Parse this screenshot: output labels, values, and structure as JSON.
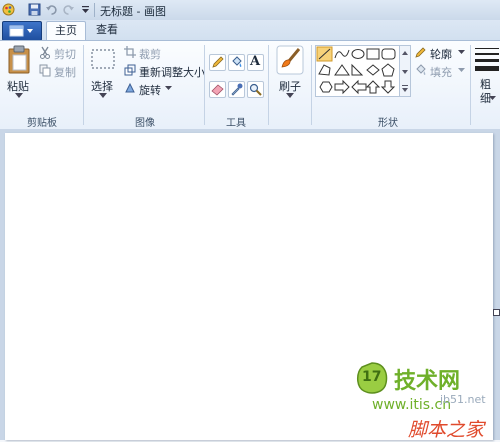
{
  "window": {
    "title": "无标题 - 画图"
  },
  "tabs": [
    {
      "label": "主页",
      "active": true
    },
    {
      "label": "查看",
      "active": false
    }
  ],
  "clipboard": {
    "group_label": "剪贴板",
    "paste_label": "粘贴",
    "cut_label": "剪切",
    "copy_label": "复制"
  },
  "image": {
    "group_label": "图像",
    "select_label": "选择",
    "crop_label": "裁剪",
    "resize_label": "重新调整大小",
    "rotate_label": "旋转"
  },
  "tools": {
    "group_label": "工具",
    "text_tool_glyph": "A"
  },
  "brushes": {
    "label": "刷子"
  },
  "shapes": {
    "group_label": "形状",
    "outline_label": "轮廓",
    "fill_label": "填充"
  },
  "size": {
    "label_line1": "粗",
    "label_line2": "细"
  },
  "watermark": {
    "logo_text": "17",
    "brand_text": "技术网",
    "url_text": "www.itis.cn",
    "partial_text": "jb51.net",
    "sub_text": "脚本之家"
  },
  "colors": {
    "accent": "#2b5ea8",
    "ribbon_bg": "#f2f6fb",
    "canvas_bg": "#ffffff",
    "workspace_bg": "#c9d6e7",
    "watermark_green": "#6fb02a",
    "watermark_red": "#e04a2c"
  }
}
